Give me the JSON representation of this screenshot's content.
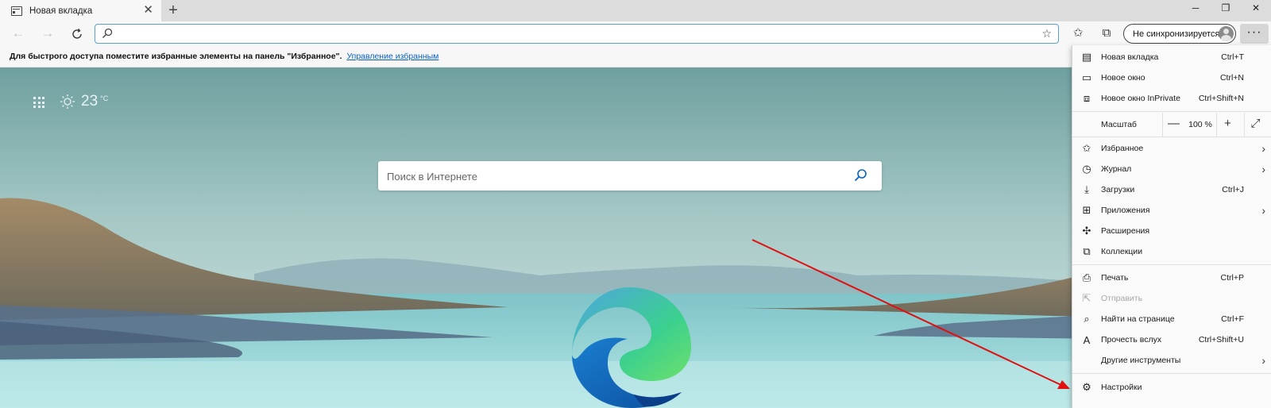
{
  "window": {
    "tab_title": "Новая вкладка",
    "minimize": "─",
    "restore": "❐",
    "close": "✕"
  },
  "toolbar": {
    "address_value": "",
    "profile_label": "Не синхронизируется",
    "more_label": "···"
  },
  "favorites_bar": {
    "message": "Для быстрого доступа поместите избранные элементы на панель \"Избранное\".",
    "link": "Управление избранным"
  },
  "newtab": {
    "weather_temp": "23",
    "weather_unit": "°C",
    "search_placeholder": "Поиск в Интернете"
  },
  "menu": {
    "items": [
      {
        "label": "Новая вкладка",
        "shortcut": "Ctrl+T",
        "icon": "new-tab-icon"
      },
      {
        "label": "Новое окно",
        "shortcut": "Ctrl+N",
        "icon": "new-window-icon"
      },
      {
        "label": "Новое окно InPrivate",
        "shortcut": "Ctrl+Shift+N",
        "icon": "inprivate-icon"
      },
      {
        "label": "Избранное",
        "shortcut": "",
        "icon": "favorites-icon"
      },
      {
        "label": "Журнал",
        "shortcut": "",
        "icon": "history-icon"
      },
      {
        "label": "Загрузки",
        "shortcut": "Ctrl+J",
        "icon": "downloads-icon"
      },
      {
        "label": "Приложения",
        "shortcut": "",
        "icon": "apps-icon"
      },
      {
        "label": "Расширения",
        "shortcut": "",
        "icon": "extensions-icon"
      },
      {
        "label": "Коллекции",
        "shortcut": "",
        "icon": "collections-icon"
      },
      {
        "label": "Печать",
        "shortcut": "Ctrl+P",
        "icon": "print-icon"
      },
      {
        "label": "Отправить",
        "shortcut": "",
        "icon": "share-icon"
      },
      {
        "label": "Найти на странице",
        "shortcut": "Ctrl+F",
        "icon": "find-icon"
      },
      {
        "label": "Прочесть вслух",
        "shortcut": "Ctrl+Shift+U",
        "icon": "read-aloud-icon"
      },
      {
        "label": "Другие инструменты",
        "shortcut": "",
        "icon": "more-tools-icon"
      },
      {
        "label": "Настройки",
        "shortcut": "",
        "icon": "settings-icon"
      }
    ],
    "zoom": {
      "label": "Масштаб",
      "minus": "—",
      "value": "100 %",
      "plus": "+"
    }
  },
  "colors": {
    "annotation_arrow": "#e01010",
    "address_border": "#5a9fd4",
    "link": "#0a5fc7"
  }
}
